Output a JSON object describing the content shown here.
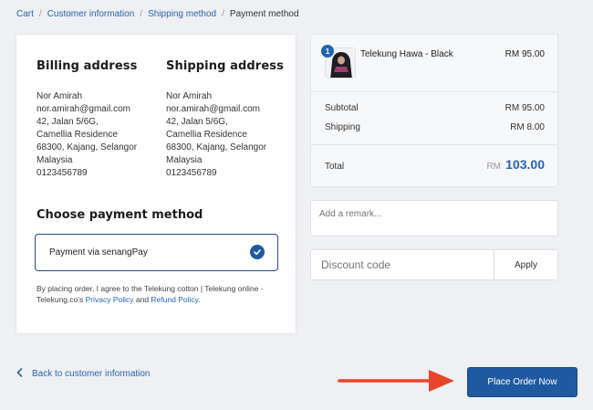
{
  "breadcrumb": {
    "cart": "Cart",
    "customer_info": "Customer information",
    "shipping_method": "Shipping method",
    "payment_method": "Payment method",
    "separator": "/"
  },
  "billing": {
    "title": "Billing address",
    "lines": [
      "Nor Amirah",
      "nor.amirah@gmail.com",
      "42, Jalan 5/6G,",
      "Camellia Residence",
      "68300, Kajang, Selangor",
      "Malaysia",
      "0123456789"
    ]
  },
  "shipping": {
    "title": "Shipping address",
    "lines": [
      "Nor Amirah",
      "nor.amirah@gmail.com",
      "42, Jalan 5/6G,",
      "Camellia Residence",
      "68300, Kajang, Selangor",
      "Malaysia",
      "0123456789"
    ]
  },
  "payment": {
    "title": "Choose payment method",
    "option": "Payment via senangPay",
    "policy_prefix": "By placing order, I agree to the Telekung cotton | Telekung online - Telekung.co's ",
    "privacy_link": "Privacy Policy",
    "and": " and ",
    "refund_link": "Refund Policy",
    "suffix": "."
  },
  "summary": {
    "product_name": "Telekung Hawa - Black",
    "product_qty": "1",
    "product_price": "RM 95.00",
    "subtotal_label": "Subtotal",
    "subtotal_value": "RM 95.00",
    "shipping_label": "Shipping",
    "shipping_value": "RM 8.00",
    "total_label": "Total",
    "total_currency": "RM",
    "total_amount": "103.00"
  },
  "remark": {
    "placeholder": "Add a remark..."
  },
  "discount": {
    "placeholder": "Discount code",
    "apply_label": "Apply"
  },
  "footer": {
    "back_label": "Back to customer information",
    "place_order_label": "Place Order Now"
  },
  "colors": {
    "accent": "#1f5aa0",
    "link": "#2a64ad",
    "arrow": "#e8452c"
  },
  "icons": [
    "chevron-left-icon",
    "check-circle-icon",
    "arrow-right-icon"
  ]
}
